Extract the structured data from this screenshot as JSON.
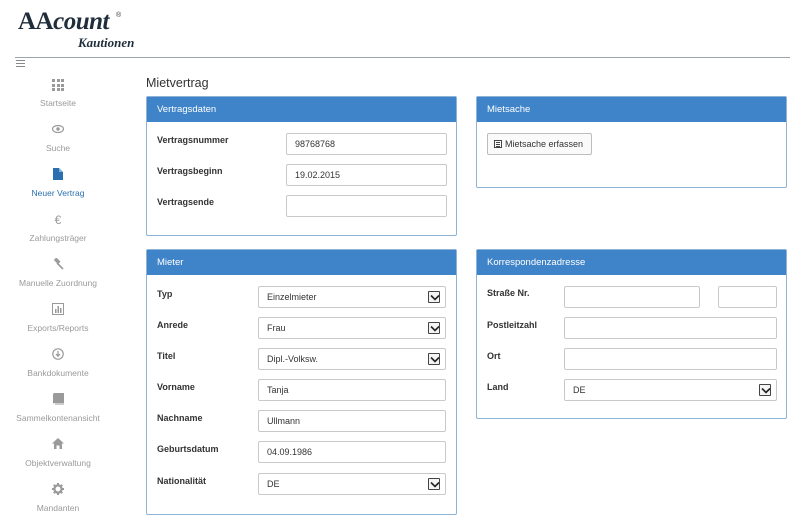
{
  "logo": {
    "part1": "AA",
    "part2": "count",
    "reg": "®",
    "sub": "Kautionen"
  },
  "sidebar": {
    "items": [
      {
        "label": "Startseite",
        "icon": "grid-icon"
      },
      {
        "label": "Suche",
        "icon": "eye-icon"
      },
      {
        "label": "Neuer Vertrag",
        "icon": "document-icon",
        "active": true
      },
      {
        "label": "Zahlungsträger",
        "icon": "euro-icon"
      },
      {
        "label": "Manuelle Zuordnung",
        "icon": "gavel-icon"
      },
      {
        "label": "Exports/Reports",
        "icon": "bar-chart-icon"
      },
      {
        "label": "Bankdokumente",
        "icon": "download-circle-icon"
      },
      {
        "label": "Sammelkontenansicht",
        "icon": "book-icon"
      },
      {
        "label": "Objektverwaltung",
        "icon": "home-icon"
      },
      {
        "label": "Mandanten",
        "icon": "cog-icon"
      }
    ]
  },
  "page": {
    "title": "Mietvertrag"
  },
  "vertragsdaten": {
    "title": "Vertragsdaten",
    "vertragsnummer_label": "Vertragsnummer",
    "vertragsnummer": "98768768",
    "vertragsbeginn_label": "Vertragsbeginn",
    "vertragsbeginn": "19.02.2015",
    "vertragsende_label": "Vertragsende",
    "vertragsende": ""
  },
  "mietsache": {
    "title": "Mietsache",
    "button_label": "Mietsache erfassen"
  },
  "mieter": {
    "title": "Mieter",
    "typ_label": "Typ",
    "typ": "Einzelmieter",
    "anrede_label": "Anrede",
    "anrede": "Frau",
    "titel_label": "Titel",
    "titel": "Dipl.-Volksw.",
    "vorname_label": "Vorname",
    "vorname": "Tanja",
    "nachname_label": "Nachname",
    "nachname": "Ullmann",
    "geburtsdatum_label": "Geburtsdatum",
    "geburtsdatum": "04.09.1986",
    "nationalitaet_label": "Nationalität",
    "nationalitaet": "DE"
  },
  "korrespondenz": {
    "title": "Korrespondenzadresse",
    "strasse_label": "Straße Nr.",
    "strasse": "",
    "hausnummer": "",
    "plz_label": "Postleitzahl",
    "plz": "",
    "ort_label": "Ort",
    "ort": "",
    "land_label": "Land",
    "land": "DE"
  },
  "colors": {
    "accent": "#3f84c8",
    "active_nav": "#2a6fb0"
  }
}
